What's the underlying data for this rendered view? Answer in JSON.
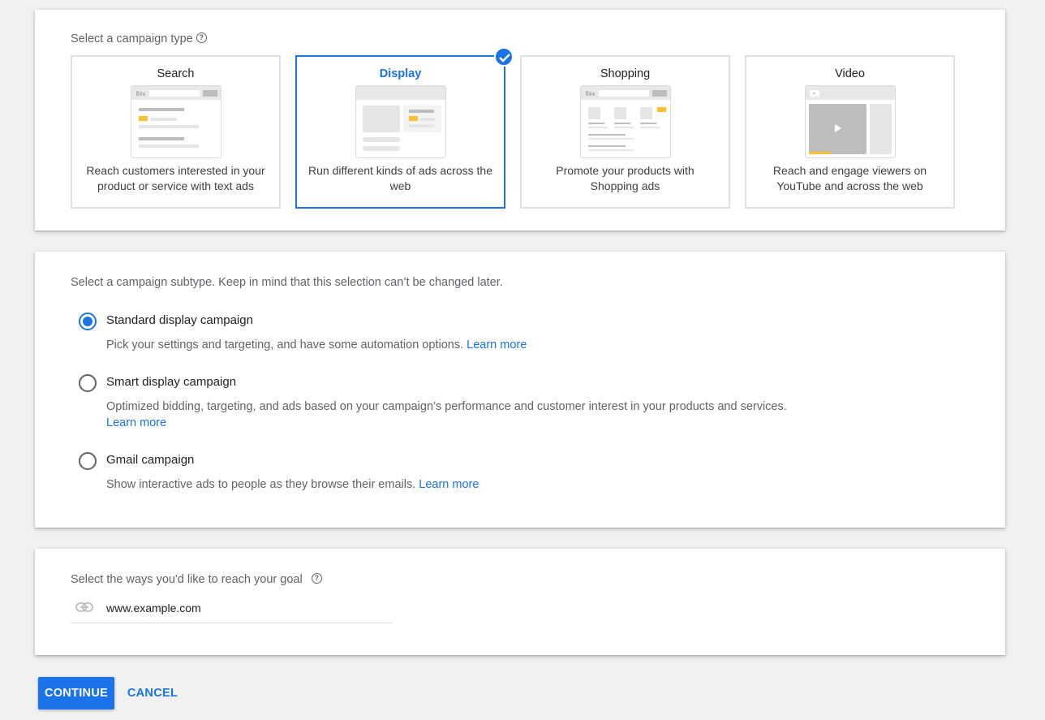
{
  "campaign_type": {
    "label": "Select a campaign type",
    "help_icon": "help-circle-icon",
    "selected": "Display",
    "types": [
      {
        "title": "Search",
        "description": "Reach customers interested in your product or service with text ads",
        "illustration": "search-results-illustration",
        "selected": false
      },
      {
        "title": "Display",
        "description": "Run different kinds of ads across the web",
        "illustration": "display-ads-illustration",
        "selected": true
      },
      {
        "title": "Shopping",
        "description": "Promote your products with Shopping ads",
        "illustration": "shopping-ads-illustration",
        "selected": false
      },
      {
        "title": "Video",
        "description": "Reach and engage viewers on YouTube and across the web",
        "illustration": "video-ads-illustration",
        "selected": false
      }
    ],
    "selected_badge_icon": "check-circle-icon"
  },
  "campaign_subtype": {
    "label": "Select a campaign subtype. Keep in mind that this selection can’t be changed later.",
    "options": [
      {
        "label": "Standard display campaign",
        "description": "Pick your settings and targeting, and have some automation options.",
        "link": "Learn more",
        "checked": true
      },
      {
        "label": "Smart display campaign",
        "description": "Optimized bidding, targeting, and ads based on your campaign’s performance and customer interest in your products and services.",
        "link": "Learn more",
        "checked": false
      },
      {
        "label": "Gmail campaign",
        "description": "Show interactive ads to people as they browse their emails.",
        "link": "Learn more",
        "checked": false
      }
    ]
  },
  "goal": {
    "label": "Select the ways you'd like to reach your goal",
    "help_icon": "help-circle-icon",
    "url_icon": "link-icon",
    "url_value": "www.example.com"
  },
  "actions": {
    "continue_label": "CONTINUE",
    "cancel_label": "CANCEL"
  },
  "colors": {
    "accent": "#1a73e8",
    "ad_highlight": "#fbc02d",
    "background": "#f1f1f1"
  }
}
